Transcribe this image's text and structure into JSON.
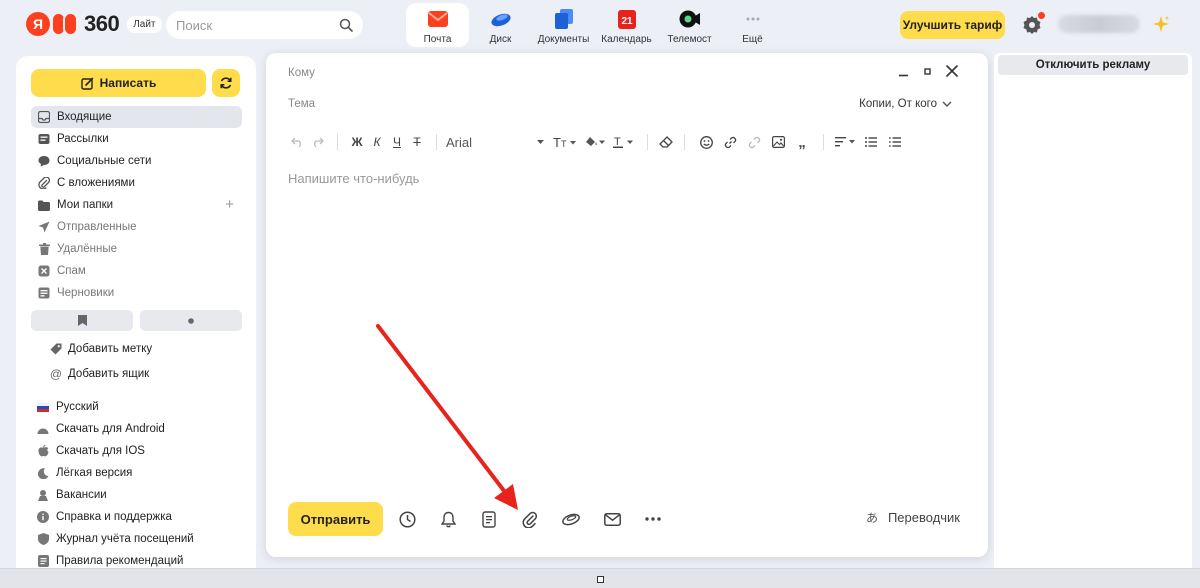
{
  "header": {
    "logo_letter": "Я",
    "logo_number": "360",
    "logo_badge": "Лайт",
    "search_placeholder": "Поиск",
    "services": [
      {
        "label": "Почта",
        "icon": "mail-envelope-icon",
        "active": true
      },
      {
        "label": "Диск",
        "icon": "disk-cloud-icon",
        "active": false
      },
      {
        "label": "Документы",
        "icon": "documents-icon",
        "active": false
      },
      {
        "label": "Календарь",
        "icon": "calendar-icon",
        "active": false,
        "badge": "21"
      },
      {
        "label": "Телемост",
        "icon": "telemost-camera-icon",
        "active": false
      },
      {
        "label": "Ещё",
        "icon": "more-grid-icon",
        "active": false
      }
    ],
    "upgrade_label": "Улучшить тариф"
  },
  "sidebar": {
    "compose_label": "Написать",
    "folders": [
      {
        "label": "Входящие",
        "icon": "inbox-icon",
        "active": true
      },
      {
        "label": "Рассылки",
        "icon": "newsletter-icon"
      },
      {
        "label": "Социальные сети",
        "icon": "social-icon"
      },
      {
        "label": "С вложениями",
        "icon": "paperclip-icon"
      },
      {
        "label": "Мои папки",
        "icon": "folder-icon",
        "addable": true
      },
      {
        "label": "Отправленные",
        "icon": "sent-icon",
        "muted": true
      },
      {
        "label": "Удалённые",
        "icon": "trash-icon",
        "muted": true
      },
      {
        "label": "Спам",
        "icon": "spam-icon",
        "muted": true
      },
      {
        "label": "Черновики",
        "icon": "drafts-icon",
        "muted": true
      }
    ],
    "add_links": [
      {
        "label": "Добавить метку",
        "icon": "tag-icon"
      },
      {
        "label": "Добавить ящик",
        "icon": "at-sign-icon"
      }
    ],
    "footer_links": [
      {
        "label": "Русский",
        "icon": "russia-flag-icon"
      },
      {
        "label": "Скачать для Android",
        "icon": "android-icon"
      },
      {
        "label": "Скачать для IOS",
        "icon": "apple-icon"
      },
      {
        "label": "Лёгкая версия",
        "icon": "moon-icon"
      },
      {
        "label": "Вакансии",
        "icon": "vacancy-icon"
      },
      {
        "label": "Справка и поддержка",
        "icon": "info-icon"
      },
      {
        "label": "Журнал учёта посещений",
        "icon": "shield-icon"
      },
      {
        "label": "Правила рекомендаций",
        "icon": "rules-icon"
      }
    ]
  },
  "composer": {
    "to_label": "Кому",
    "subject_label": "Тема",
    "cc_label": "Копии, От кого",
    "font_name": "Arial",
    "format_bold": "Ж",
    "format_italic": "К",
    "format_underline": "Ч",
    "format_strike": "Т",
    "body_placeholder": "Напишите что-нибудь",
    "send_label": "Отправить",
    "translator_label": "Переводчик"
  },
  "ads": {
    "disable_label": "Отключить рекламу"
  },
  "colors": {
    "accent_yellow": "#ffdc4c",
    "brand_red": "#fc3f1d",
    "page_bg": "#edeff7",
    "annotation_red": "#e8231c"
  }
}
